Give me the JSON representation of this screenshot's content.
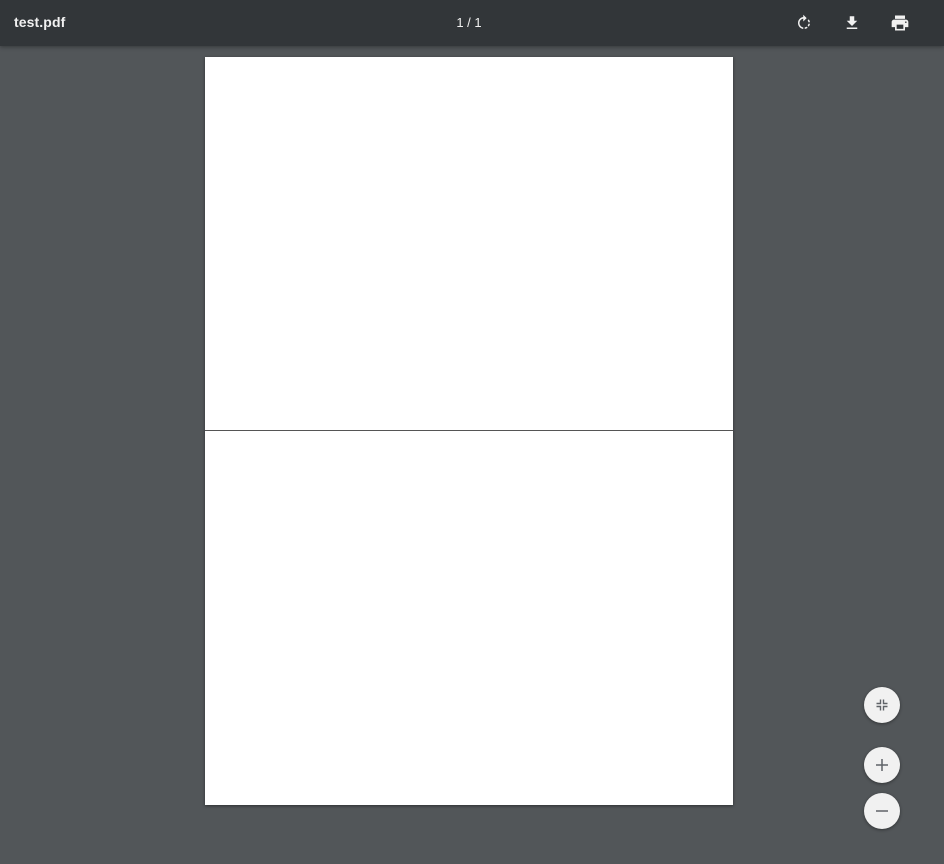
{
  "toolbar": {
    "title": "test.pdf",
    "page_indicator": "1 / 1",
    "buttons": {
      "rotate": "rotate-clockwise-icon",
      "download": "download-icon",
      "print": "print-icon"
    }
  },
  "zoom_controls": {
    "fit": "fit-to-page-icon",
    "zoom_in": "plus-icon",
    "zoom_out": "minus-icon"
  },
  "colors": {
    "toolbar_bg": "#323639",
    "viewer_bg": "#525659",
    "page_bg": "#ffffff",
    "fab_bg": "#f1f1f1"
  }
}
